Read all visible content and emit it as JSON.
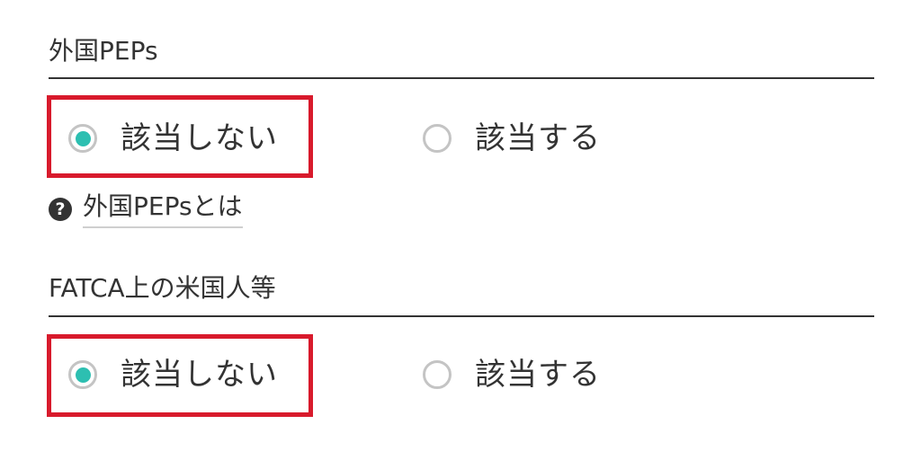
{
  "sections": [
    {
      "title": "外国PEPs",
      "options": [
        {
          "label": "該当しない",
          "selected": true
        },
        {
          "label": "該当する",
          "selected": false
        }
      ],
      "help_link": "外国PEPsとは",
      "help_icon": "question-circle-icon"
    },
    {
      "title": "FATCA上の米国人等",
      "options": [
        {
          "label": "該当しない",
          "selected": true
        },
        {
          "label": "該当する",
          "selected": false
        }
      ]
    }
  ],
  "colors": {
    "radio_selected": "#2dbfb1",
    "highlight_border": "#d81a2c",
    "text": "#333333"
  }
}
